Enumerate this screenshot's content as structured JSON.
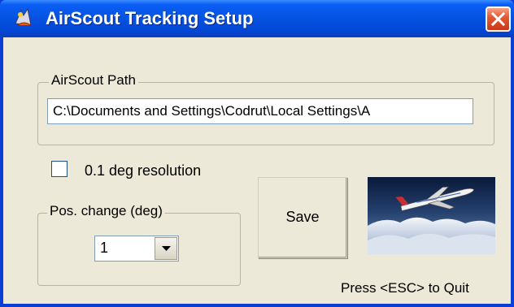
{
  "window": {
    "title": "AirScout Tracking Setup",
    "icons": {
      "app": "airscout-app-icon",
      "close": "close-icon"
    },
    "colors": {
      "titlebar": "#0554e3",
      "close_button": "#e35a35",
      "client": "#ece9d8"
    }
  },
  "path_group": {
    "legend": "AirScout Path",
    "value": "C:\\Documents and Settings\\Codrut\\Local Settings\\A"
  },
  "resolution": {
    "label": "0.1 deg resolution",
    "checked": false
  },
  "pos_change_group": {
    "legend": "Pos. change (deg)",
    "selected": "1",
    "arrow_icon": "chevron-down-icon"
  },
  "save_button": {
    "label": "Save"
  },
  "image": {
    "description_icon": "airplane-clouds-image"
  },
  "hint": "Press <ESC> to Quit"
}
